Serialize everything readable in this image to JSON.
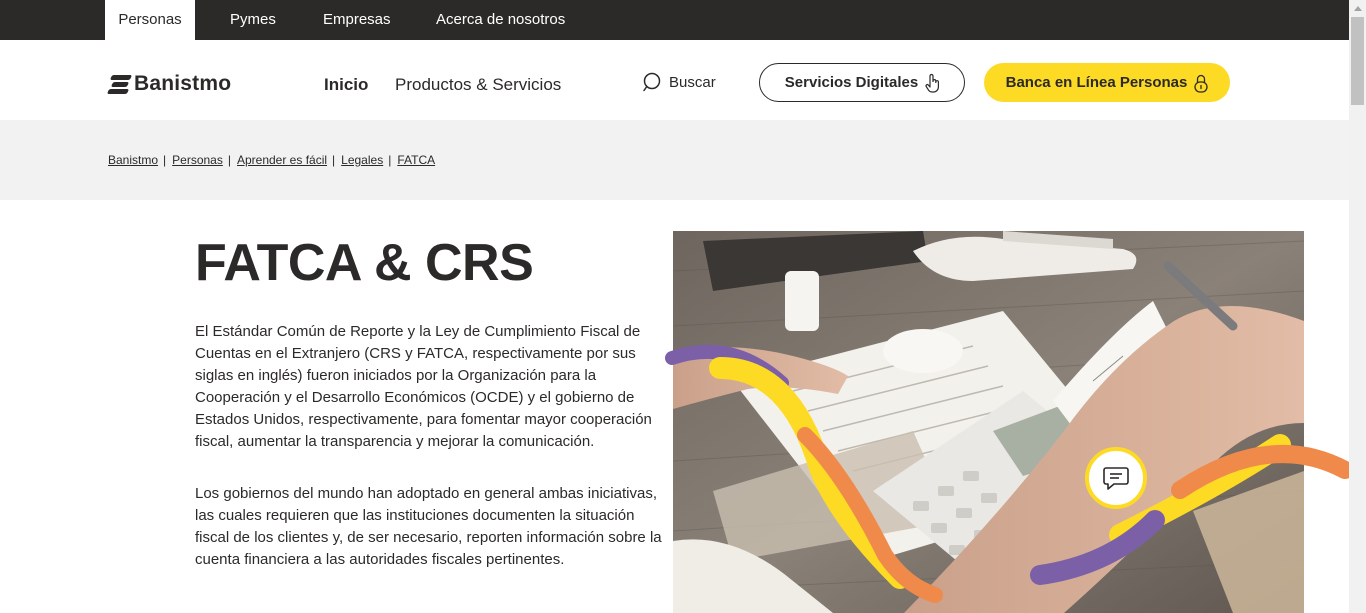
{
  "topbar": {
    "tabs": [
      "Personas",
      "Pymes",
      "Empresas",
      "Acerca de nosotros"
    ]
  },
  "header": {
    "logo_text": "Banistmo",
    "nav": [
      "Inicio",
      "Productos & Servicios"
    ],
    "search_label": "Buscar",
    "digital_button": "Servicios Digitales",
    "online_button": "Banca en Línea Personas"
  },
  "breadcrumb": [
    "Banistmo",
    "Personas",
    "Aprender es fácil",
    "Legales",
    "FATCA"
  ],
  "main": {
    "title": "FATCA & CRS",
    "paragraph1": "El Estándar Común de Reporte y la Ley de Cumplimiento Fiscal de Cuentas en el Extranjero (CRS y FATCA, respectivamente por sus siglas en inglés) fueron iniciados por la Organización para la Cooperación y el Desarrollo Económicos (OCDE) y el gobierno de Estados Unidos, respectivamente, para fomentar mayor cooperación fiscal, aumentar la transparencia y mejorar la comunicación.",
    "paragraph2": "Los gobiernos del mundo han adoptado en general ambas iniciativas, las cuales requieren que las instituciones documenten la situación fiscal de los clientes y, de ser necesario, reporten información sobre la cuenta financiera a las autoridades fiscales pertinentes."
  },
  "colors": {
    "dark": "#2c2a29",
    "brand_yellow": "#fdda24",
    "accent_orange": "#f08a4b",
    "accent_purple": "#7b60a8"
  },
  "icons": [
    "search-icon",
    "touch-hand-icon",
    "padlock-icon",
    "chat-icon"
  ]
}
